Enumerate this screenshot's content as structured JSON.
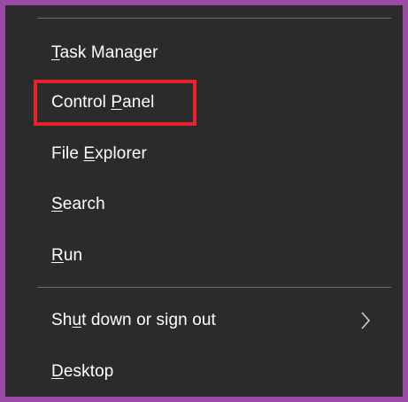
{
  "menu": {
    "items": [
      {
        "pre": "",
        "u": "T",
        "post": "ask Manager"
      },
      {
        "pre": "Control ",
        "u": "P",
        "post": "anel"
      },
      {
        "pre": "File ",
        "u": "E",
        "post": "xplorer"
      },
      {
        "pre": "",
        "u": "S",
        "post": "earch"
      },
      {
        "pre": "",
        "u": "R",
        "post": "un"
      },
      {
        "pre": "Sh",
        "u": "u",
        "post": "t down or sign out"
      },
      {
        "pre": "",
        "u": "D",
        "post": "esktop"
      }
    ],
    "submenu_icon": "chevron-right-icon",
    "highlight_color": "#e8222a",
    "background": "#2b2b2b",
    "frame_color": "#9b4aa6"
  }
}
